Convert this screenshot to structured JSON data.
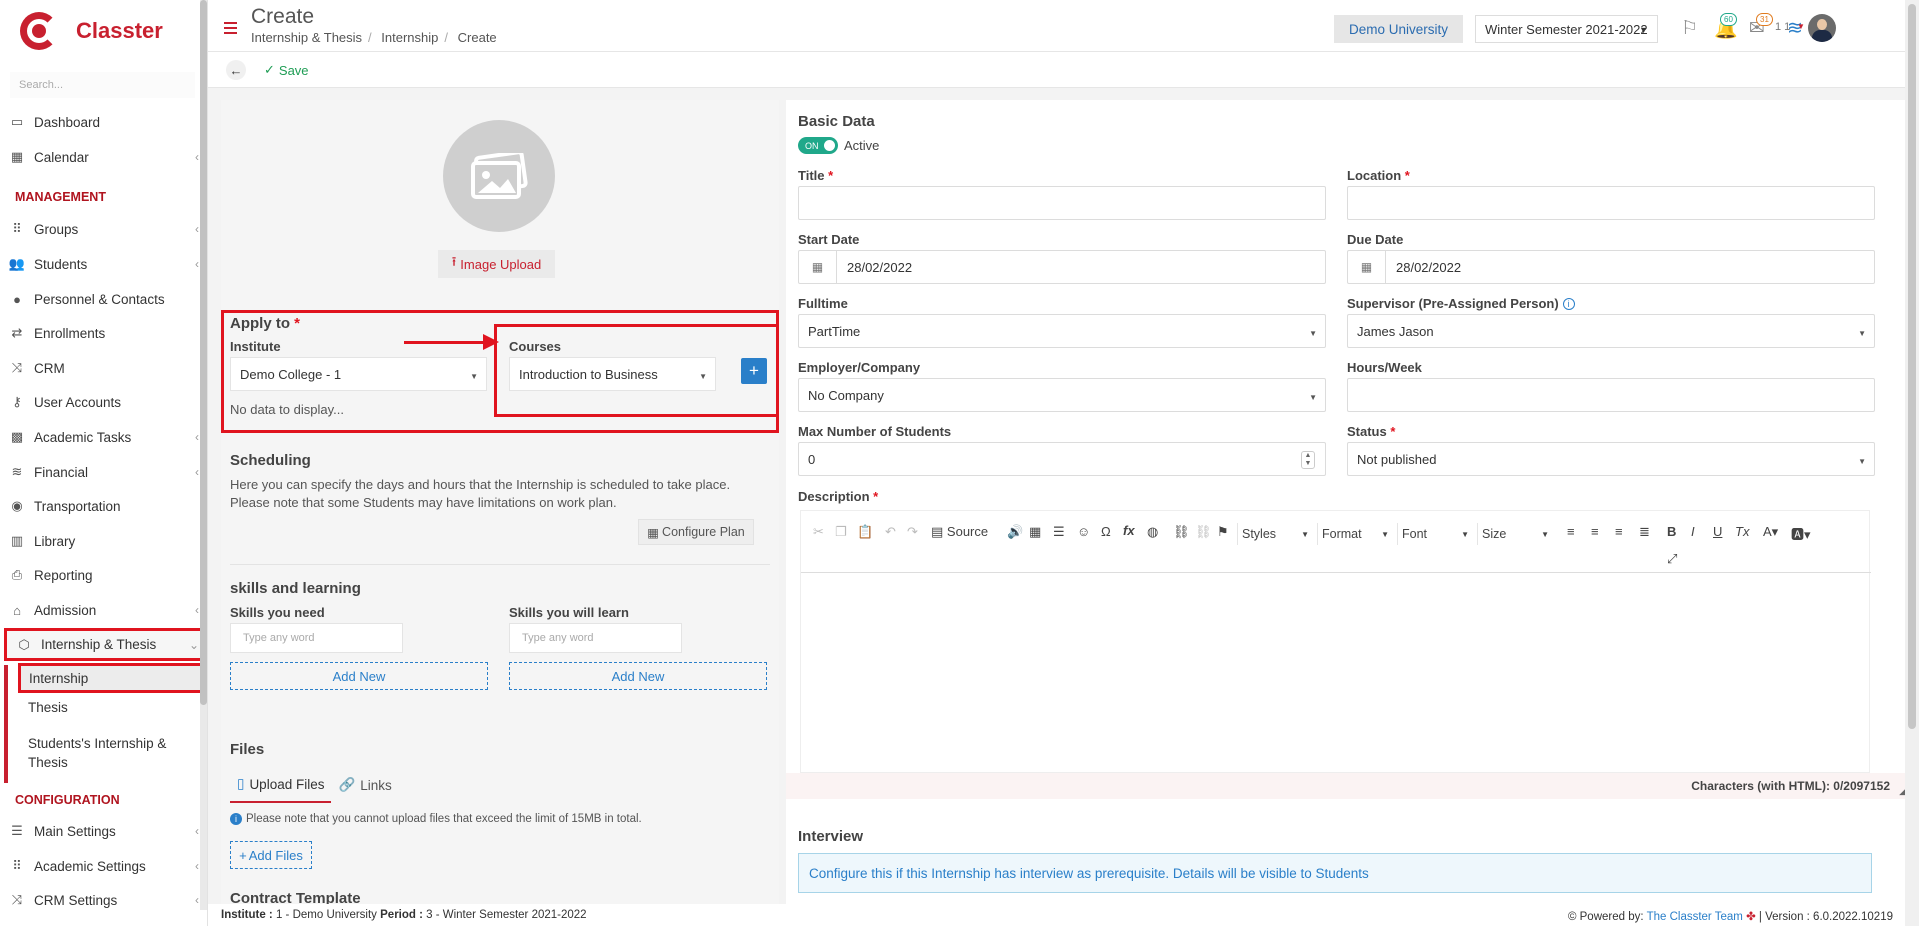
{
  "app": {
    "name": "Classter"
  },
  "sidebar": {
    "search_placeholder": "Search...",
    "items_top": [
      {
        "label": "Dashboard",
        "icon": "laptop-icon"
      },
      {
        "label": "Calendar",
        "icon": "calendar-icon"
      }
    ],
    "section_management": "MANAGEMENT",
    "items_management": [
      {
        "label": "Groups",
        "icon": "groups-icon"
      },
      {
        "label": "Students",
        "icon": "students-icon"
      },
      {
        "label": "Personnel & Contacts",
        "icon": "person-icon"
      },
      {
        "label": "Enrollments",
        "icon": "exchange-icon"
      },
      {
        "label": "CRM",
        "icon": "crm-icon"
      },
      {
        "label": "User Accounts",
        "icon": "key-icon"
      },
      {
        "label": "Academic Tasks",
        "icon": "tasks-icon"
      },
      {
        "label": "Financial",
        "icon": "coins-icon"
      },
      {
        "label": "Transportation",
        "icon": "bus-icon"
      },
      {
        "label": "Library",
        "icon": "books-icon"
      },
      {
        "label": "Reporting",
        "icon": "print-icon"
      },
      {
        "label": "Admission",
        "icon": "building-icon"
      },
      {
        "label": "Internship & Thesis",
        "icon": "box-icon"
      }
    ],
    "sub_items": [
      {
        "label": "Internship"
      },
      {
        "label": "Thesis"
      },
      {
        "label": "Students's Internship & Thesis"
      }
    ],
    "section_configuration": "CONFIGURATION",
    "items_configuration": [
      {
        "label": "Main Settings",
        "icon": "sliders-icon"
      },
      {
        "label": "Academic Settings",
        "icon": "groups-icon"
      },
      {
        "label": "CRM Settings",
        "icon": "crm-icon"
      }
    ]
  },
  "header": {
    "title": "Create",
    "breadcrumb": [
      "Internship & Thesis",
      "Internship",
      "Create"
    ],
    "university": "Demo University",
    "semester": "Winter Semester 2021-2022",
    "badge_notifications": "60",
    "badge_messages": "31",
    "user_label": "1 1"
  },
  "toolbar": {
    "save_label": "Save"
  },
  "left": {
    "image_upload": "Image Upload",
    "apply_to": "Apply to",
    "institute_label": "Institute",
    "institute_value": "Demo College - 1",
    "courses_label": "Courses",
    "courses_value": "Introduction to Business",
    "add_course": "+",
    "no_data": "No data to display...",
    "scheduling_title": "Scheduling",
    "scheduling_text_1": "Here you can specify the days and hours that the Internship is scheduled to take place.",
    "scheduling_text_2": "Please note that some Students may have limitations on work plan.",
    "configure_plan": "Configure Plan",
    "skills_title": "skills and learning",
    "skills_need_label": "Skills you need",
    "skills_learn_label": "Skills you will learn",
    "word_placeholder": "Type any word",
    "add_new": "Add New",
    "files_title": "Files",
    "tab_upload": "Upload Files",
    "tab_links": "Links",
    "files_note": "Please note that you cannot upload files that exceed the limit of 15MB in total.",
    "add_files": "Add Files",
    "contract_title": "Contract Template"
  },
  "right": {
    "basic_data": "Basic Data",
    "toggle_on": "ON",
    "active_label": "Active",
    "title_label": "Title",
    "location_label": "Location",
    "start_date_label": "Start Date",
    "start_date_value": "28/02/2022",
    "due_date_label": "Due Date",
    "due_date_value": "28/02/2022",
    "fulltime_label": "Fulltime",
    "fulltime_value": "PartTime",
    "supervisor_label": "Supervisor (Pre-Assigned Person)",
    "supervisor_value": "James Jason",
    "employer_label": "Employer/Company",
    "employer_value": "No Company",
    "hours_label": "Hours/Week",
    "max_students_label": "Max Number of Students",
    "max_students_value": "0",
    "status_label": "Status",
    "status_value": "Not published",
    "description_label": "Description",
    "editor": {
      "source": "Source",
      "styles": "Styles",
      "format": "Format",
      "font": "Font",
      "size": "Size"
    },
    "char_count": "Characters (with HTML): 0/2097152",
    "interview_title": "Interview",
    "interview_text": "Configure this if this Internship has interview as prerequisite. Details will be visible to Students"
  },
  "footer": {
    "institute_label": "Institute :",
    "institute_value": "1 - Demo University",
    "period_label": "Period :",
    "period_value": "3 - Winter Semester 2021-2022",
    "powered_by": "Powered by:",
    "team": "The Classter Team",
    "version": "| Version : 6.0.2022.10219"
  },
  "colors": {
    "brand": "#c8202f",
    "accent_blue": "#2a7fc9",
    "toggle_green": "#20a88a",
    "annotation_red": "#e0141f"
  }
}
